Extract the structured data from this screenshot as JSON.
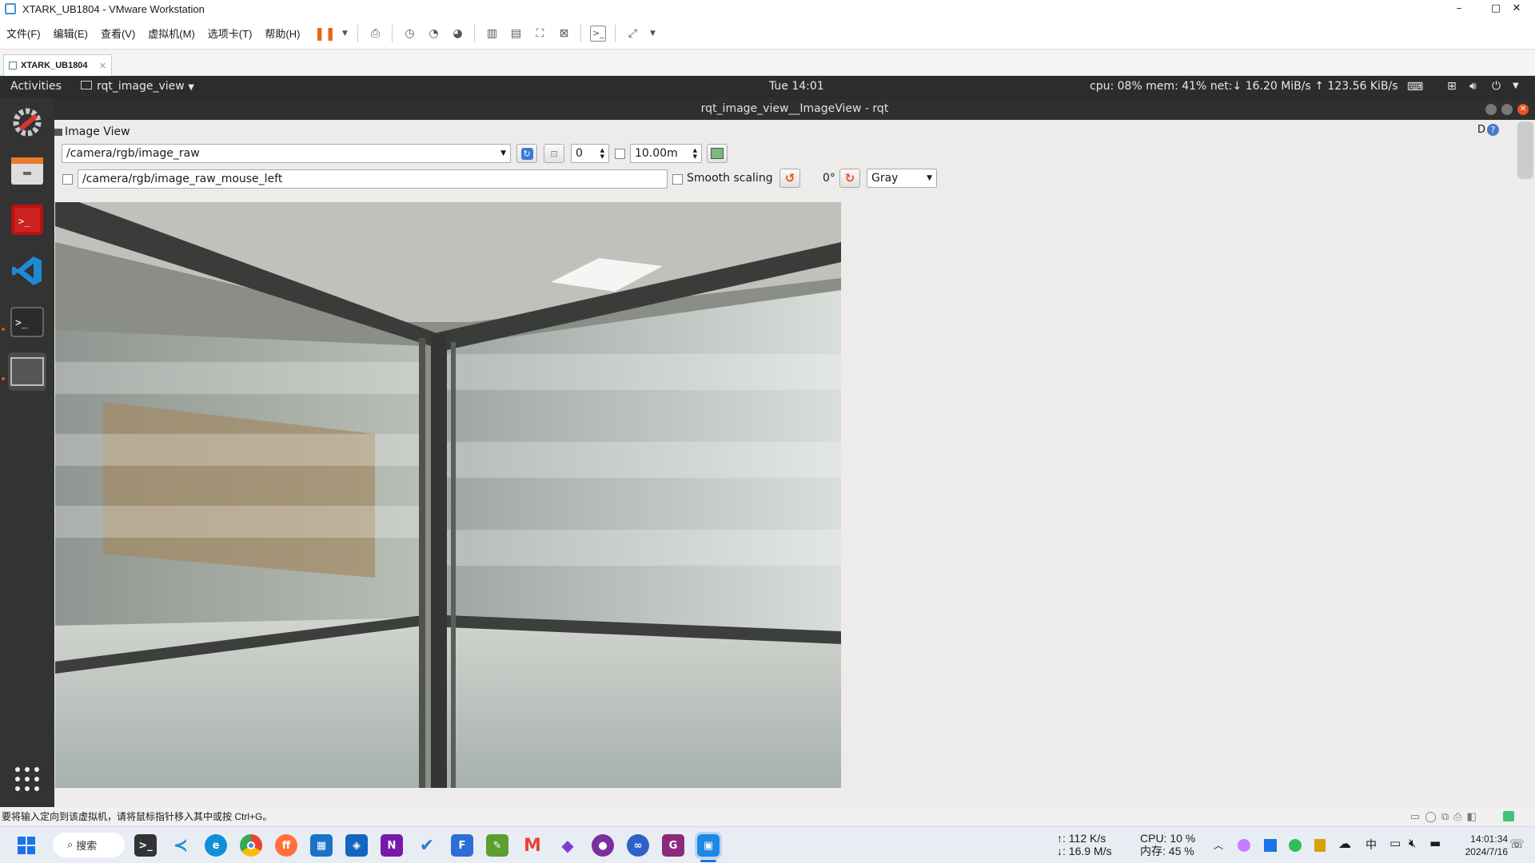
{
  "vmware": {
    "title": "XTARK_UB1804 - VMware Workstation",
    "menu": [
      "文件(F)",
      "编辑(E)",
      "查看(V)",
      "虚拟机(M)",
      "选项卡(T)",
      "帮助(H)"
    ],
    "tab": "XTARK_UB1804",
    "status": "要将输入定向到该虚拟机，请将鼠标指针移入其中或按 Ctrl+G。"
  },
  "ubuntu": {
    "activities": "Activities",
    "app": "rqt_image_view",
    "clock": "Tue 14:01",
    "stats": "cpu: 08% mem: 41% net:↓ 16.20 MiB/s ↑ 123.56 KiB/s"
  },
  "rqt": {
    "title": "rqt_image_view__ImageView - rqt",
    "dock_title": "Image View",
    "help": "D",
    "topic": "/camera/rgb/image_raw",
    "spin_value": "0",
    "max_range": "10.00m",
    "mouse_topic": "/camera/rgb/image_raw_mouse_left",
    "smooth_label": "Smooth scaling",
    "rotation": "0°",
    "color_mode": "Gray"
  },
  "taskbar": {
    "search": "搜索",
    "net_up": "↑: 112 K/s",
    "net_down": "↓: 16.9 M/s",
    "cpu": "CPU: 10 %",
    "mem": "内存: 45 %",
    "ime": "中",
    "time": "14:01:34",
    "date": "2024/7/16"
  }
}
